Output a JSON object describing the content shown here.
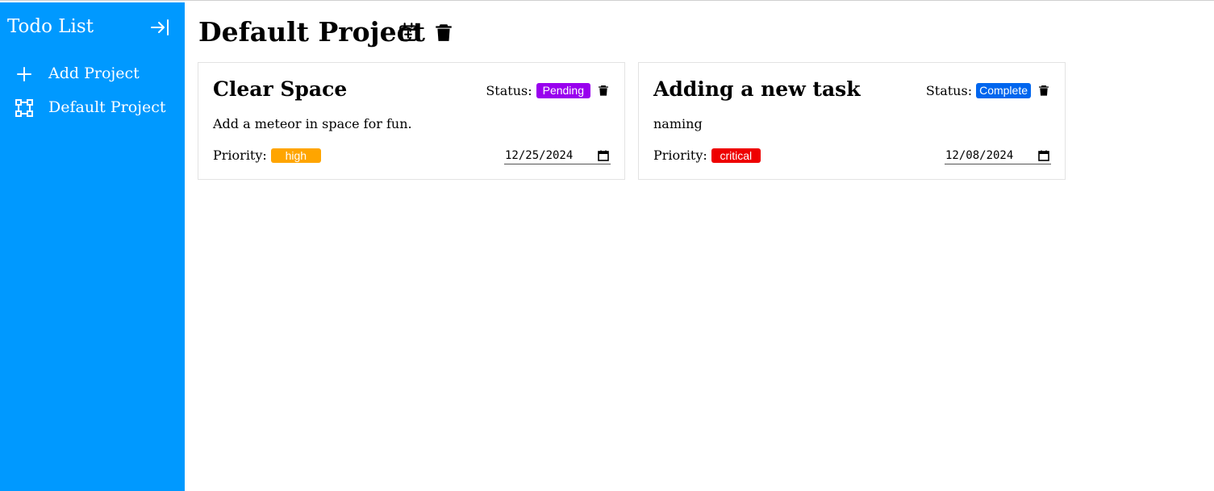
{
  "sidebar": {
    "title": "Todo List",
    "items": [
      {
        "label": "Add Project",
        "icon": "plus-icon"
      },
      {
        "label": "Default Project",
        "icon": "project-icon"
      }
    ],
    "background": "#0099ff"
  },
  "main": {
    "title": "Default Project",
    "header_icons": [
      "calendar-add-icon",
      "trash-icon"
    ]
  },
  "tasks": [
    {
      "title": "Clear Space",
      "status_label": "Status:",
      "status": "Pending",
      "status_color": "#9900ee",
      "description": "Add a meteor in space for fun.",
      "priority_label": "Priority:",
      "priority": "high",
      "priority_color": "#ffa500",
      "date": "12/25/2024"
    },
    {
      "title": "Adding a new task",
      "status_label": "Status:",
      "status": "Complete",
      "status_color": "#0066ee",
      "description": "naming",
      "priority_label": "Priority:",
      "priority": "critical",
      "priority_color": "#ee0000",
      "date": "12/08/2024"
    }
  ]
}
